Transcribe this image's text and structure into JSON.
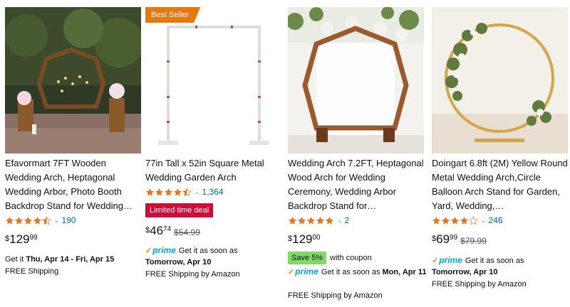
{
  "products": [
    {
      "title": "Efavormart 7FT Wooden Wedding Arch, Heptagonal Wedding Arbor, Photo Booth Backdrop Stand for Wedding…",
      "rating": 4.5,
      "review_count": "190",
      "price_currency": "$",
      "price_whole": "129",
      "price_fraction": "99",
      "delivery_prefix": "Get it ",
      "delivery_dates": "Thu, Apr 14 - Fri, Apr 15",
      "shipping": "FREE Shipping"
    },
    {
      "badge": "Best Seller",
      "title": "77in Tall x 52in Square Metal Wedding Garden Arch",
      "rating": 4.5,
      "review_count": "1,364",
      "deal_label": "Limited time deal",
      "price_currency": "$",
      "price_whole": "46",
      "price_fraction": "74",
      "list_price": "$54.99",
      "prime_label": "prime",
      "delivery_prefix": "Get it as soon as",
      "delivery_dates": "Tomorrow, Apr 10",
      "shipping": "FREE Shipping by Amazon"
    },
    {
      "title": "Wedding Arch 7.2FT, Heptagonal Wood Arch for Wedding Ceremony, Wedding Arbor Backdrop Stand for…",
      "rating": 5,
      "review_count": "2",
      "price_currency": "$",
      "price_whole": "129",
      "price_fraction": "00",
      "save_label": "Save 5%",
      "coupon_text": "with coupon",
      "prime_label": "prime",
      "delivery_prefix": "Get it as soon as",
      "delivery_dates": "Mon, Apr 11",
      "shipping": "FREE Shipping by Amazon"
    },
    {
      "title": "Doingart 6.8ft (2M) Yellow Round Metal Wedding Arch,Circle Balloon Arch Stand for Garden, Yard, Wedding,…",
      "rating": 4,
      "review_count": "246",
      "price_currency": "$",
      "price_whole": "69",
      "price_fraction": "99",
      "list_price": "$79.99",
      "prime_label": "prime",
      "delivery_prefix": "Get it as soon as",
      "delivery_dates": "Tomorrow, Apr 10",
      "shipping": "FREE Shipping by Amazon"
    }
  ],
  "colors": {
    "star": "#de7921",
    "link": "#007185",
    "prime": "#00a8e1",
    "deal": "#cc0c39",
    "best_seller": "#e47911",
    "save": "#7fda69"
  },
  "icons": [
    "star-icon",
    "chevron-down-icon",
    "prime-check-icon"
  ]
}
